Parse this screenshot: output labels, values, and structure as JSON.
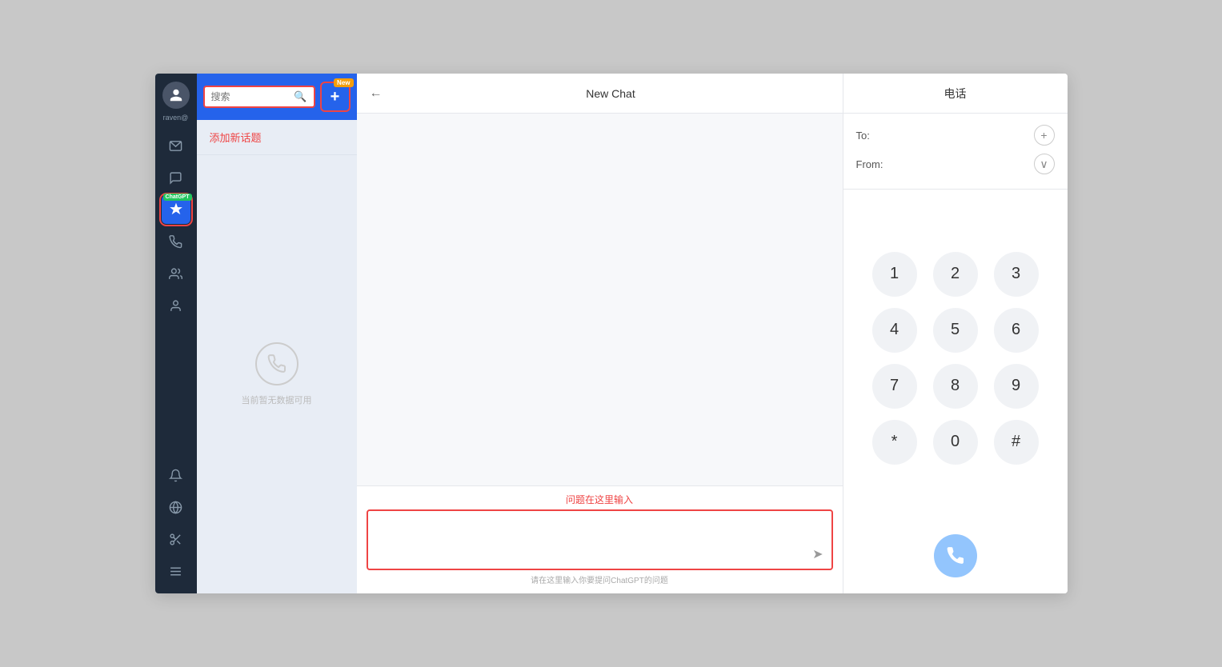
{
  "nav": {
    "username": "raven@",
    "items": [
      {
        "name": "mail-icon",
        "icon": "✉",
        "active": false
      },
      {
        "name": "chat-icon",
        "icon": "💬",
        "active": false
      },
      {
        "name": "chatgpt-icon",
        "icon": "✦",
        "active": true,
        "badge": "ChatGPT"
      },
      {
        "name": "phone-icon",
        "icon": "📞",
        "active": false
      },
      {
        "name": "contacts-icon",
        "icon": "👥",
        "active": false
      },
      {
        "name": "user-icon",
        "icon": "👤",
        "active": false
      }
    ],
    "bottom_items": [
      {
        "name": "bell-icon",
        "icon": "🔔"
      },
      {
        "name": "globe-icon",
        "icon": "🌐"
      },
      {
        "name": "scissors-icon",
        "icon": "✂"
      },
      {
        "name": "menu-icon",
        "icon": "≡"
      }
    ]
  },
  "sidebar": {
    "search_placeholder": "搜索",
    "new_badge": "New",
    "add_topic_label": "添加新话题",
    "empty_text": "当前暂无数据可用"
  },
  "chat": {
    "header_back": "←",
    "header_title": "New Chat",
    "input_label": "问题在这里输入",
    "input_placeholder": "请在这里输入你要提问ChatGPT的问题"
  },
  "phone": {
    "title": "电话",
    "to_label": "To:",
    "from_label": "From:",
    "keys": [
      [
        "1",
        "2",
        "3"
      ],
      [
        "4",
        "5",
        "6"
      ],
      [
        "7",
        "8",
        "9"
      ],
      [
        "*",
        "0",
        "#"
      ]
    ]
  }
}
